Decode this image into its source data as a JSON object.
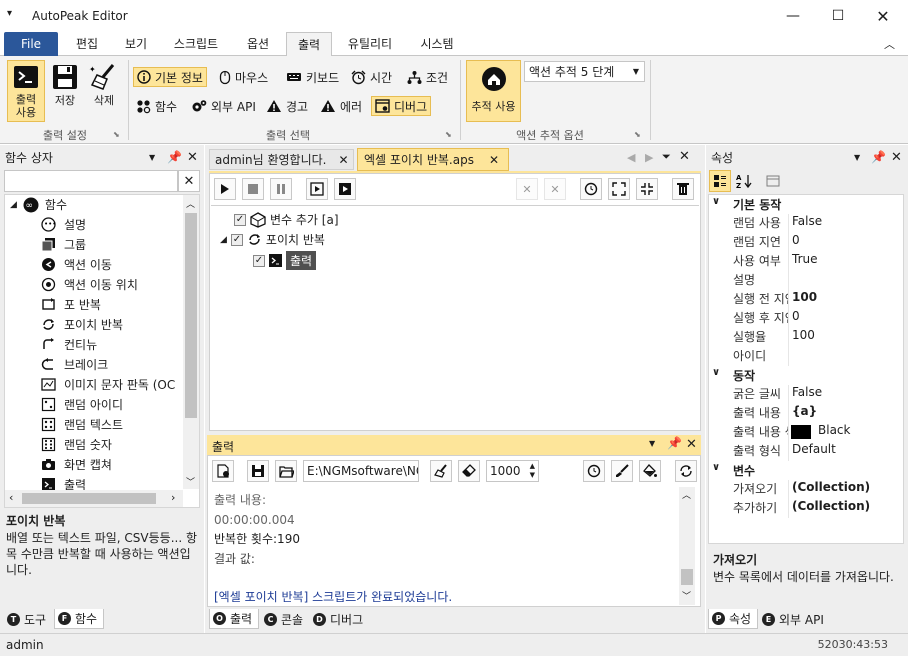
{
  "app": {
    "title": "AutoPeak Editor",
    "status_user": "admin",
    "status_time": "52030:43:53"
  },
  "menu": [
    "File",
    "편집",
    "보기",
    "스크립트",
    "옵션",
    "출력",
    "유틸리티",
    "시스템"
  ],
  "ribbon": {
    "output_use": "출력\n사용",
    "save": "저장",
    "delete": "삭제",
    "group1": "출력 설정",
    "basic_info": "기본 정보",
    "mouse": "마우스",
    "keyboard": "키보드",
    "time": "시간",
    "condition": "조건",
    "function": "함수",
    "external_api": "외부 API",
    "warning": "경고",
    "error": "에러",
    "debug": "디버그",
    "group2": "출력 선택",
    "track_use": "추적 사용",
    "track_level": "액션 추적 5 단계",
    "group3": "액션 추적 옵션"
  },
  "left": {
    "title": "함수 상자",
    "root": "함수",
    "items": [
      "설명",
      "그룹",
      "액션 이동",
      "액션 이동 위치",
      "포 반복",
      "포이치 반복",
      "컨티뉴",
      "브레이크",
      "이미지 문자 판독 (OC",
      "랜덤 아이디",
      "랜덤 텍스트",
      "랜덤 숫자",
      "화면 캡쳐",
      "출력"
    ],
    "desc_title": "포이치 반복",
    "desc_text": "배열 또는 텍스트 파일, CSV등등... 항목 수만큼 반복할 때 사용하는 액션입니다.",
    "tab_tool": "도구",
    "tab_func": "함수"
  },
  "center": {
    "tab1": "admin님 환영합니다.",
    "tab2": "엑셀 포이치 반복.aps",
    "tree": [
      "변수 추가 [a]",
      "포이치 반복",
      "출력"
    ]
  },
  "output": {
    "title": "출력",
    "path": "E:\\NGMsoftware\\NG",
    "count": "1000",
    "lines": [
      "출력 내용:",
      "00:00:00.004",
      "반복한 횟수:190",
      "결과 값:",
      "",
      "[엑셀 포이치 반복] 스크립트가 완료되었습니다."
    ],
    "tab_out": "출력",
    "tab_console": "콘솔",
    "tab_debug": "디버그"
  },
  "props": {
    "title": "속성",
    "cat1": "기본 동작",
    "rows1": [
      [
        "랜덤 사용",
        "False"
      ],
      [
        "랜덤 지연",
        "0"
      ],
      [
        "사용 여부",
        "True"
      ],
      [
        "설명",
        ""
      ],
      [
        "실행 전 지연",
        "100"
      ],
      [
        "실행 후 지연",
        "0"
      ],
      [
        "실행율",
        "100"
      ],
      [
        "아이디",
        ""
      ]
    ],
    "cat2": "동작",
    "rows2": [
      [
        "굵은 글씨",
        "False"
      ],
      [
        "출력 내용",
        "{a}"
      ],
      [
        "출력 내용 색",
        "Black"
      ],
      [
        "출력 형식",
        "Default"
      ]
    ],
    "cat3": "변수",
    "rows3": [
      [
        "가져오기",
        "(Collection)"
      ],
      [
        "추가하기",
        "(Collection)"
      ]
    ],
    "desc_title": "가져오기",
    "desc_text": "변수 목록에서 데이터를 가져옵니다.",
    "tab_props": "속성",
    "tab_api": "외부 API"
  }
}
